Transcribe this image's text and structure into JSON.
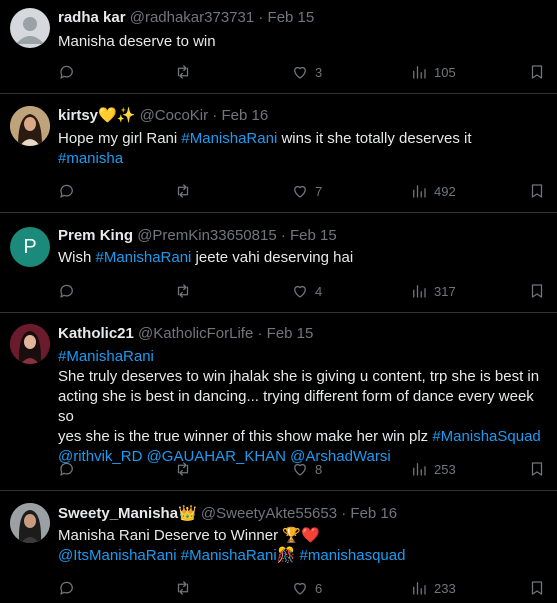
{
  "tweets": [
    {
      "name": "radha kar",
      "handle": "@radhakar373731",
      "date": "Feb 15",
      "text": "Manisha deserve to win",
      "likes": "3",
      "views": "105",
      "avatar_letter": ""
    },
    {
      "name": "kirtsy",
      "name_emoji": "💛✨",
      "handle": "@CocoKir",
      "date": "Feb 16",
      "text1": "Hope my girl Rani ",
      "tag1": "#ManishaRani",
      "text2": " wins it she totally deserves it",
      "tag2": "#manisha",
      "likes": "7",
      "views": "492"
    },
    {
      "name": "Prem King",
      "handle": "@PremKin33650815",
      "date": "Feb 15",
      "text1": "Wish ",
      "tag1": "#ManishaRani",
      "text2": " jeete vahi deserving hai",
      "likes": "4",
      "views": "317",
      "avatar_letter": "P",
      "avatar_color": "#1b8a7a"
    },
    {
      "name": "Katholic21",
      "handle": "@KatholicForLife",
      "date": "Feb 15",
      "tag1": "#ManishaRani",
      "line1": "She truly deserves to win jhalak she is giving u content, trp she is best in",
      "line2": "acting she is best in dancing... trying different form of dance every week so",
      "line3a": "yes she is the true winner of this show make her win plz ",
      "tag2": "#ManishaSquad",
      "mentions": "@rithvik_RD @GAUAHAR_KHAN @ArshadWarsi",
      "likes": "8",
      "views": "253"
    },
    {
      "name": "Sweety_Manisha",
      "name_emoji": "👑",
      "handle": "@SweetyAkte55653",
      "date": "Feb 16",
      "text1": "Manisha Rani Deserve to Winner ",
      "text_emoji": "🏆❤️",
      "mention": "@ItsManishaRani",
      "tag1": "#ManishaRani",
      "tag1_emoji": "🎊",
      "tag2": "#manishasquad",
      "likes": "6",
      "views": "233"
    }
  ],
  "separator": " · ",
  "icons": [
    "reply-icon",
    "repost-icon",
    "like-icon",
    "views-icon",
    "bookmark-icon"
  ]
}
